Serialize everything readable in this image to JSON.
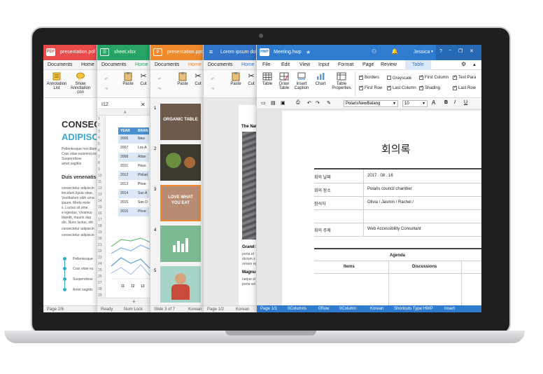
{
  "pdf": {
    "badge": "PDF",
    "title": "presentation.pdf",
    "menu": [
      "Documents",
      "Home"
    ],
    "tools": [
      "Annotation List",
      "Show Annotation con"
    ],
    "heading1": "CONSEC",
    "heading2": "ADIPISC",
    "body_lines": [
      "Pellentesque non libero",
      "Cras vitae euismod es",
      "Suspendisse",
      "amet sagittis"
    ],
    "subheading": "Duis venenatis",
    "para_lines": [
      "consectetur adipiscin",
      "tincidunt ligula vitae,",
      "Vestibulum nibh urna",
      "ipsum. Morbi mole",
      "s. Luctus sit ame",
      "e egestas. Vivamus",
      "blandit, mauris dap",
      "din. Nunc luctus, elit",
      "consectetur adipiscin",
      "consectetur adipiscin"
    ],
    "bullets": [
      "Pellentesque",
      "Cras vitae eu",
      "Suspendisse",
      "Amet sagittis"
    ],
    "status": "Page 2/6",
    "color": "#e94b4b"
  },
  "sheet": {
    "title": "sheet.xlsx",
    "menu": [
      "Documents",
      "Home"
    ],
    "tools": [
      "Paste",
      "Cut"
    ],
    "cellref": "I12",
    "col_header": "A",
    "table_headers": [
      "YEAR",
      "BRAN"
    ],
    "years": [
      "2006",
      "2007",
      "2008",
      "2011",
      "2012",
      "2013",
      "2014",
      "2015",
      "2016"
    ],
    "brands": [
      "New",
      "Los A",
      "Atlan",
      "Hous",
      "Philad",
      "Phoe",
      "San A",
      "San D",
      "Phoe"
    ],
    "row_numbers": [
      "1",
      "2",
      "3",
      "4",
      "5",
      "6",
      "7",
      "8",
      "9",
      "10",
      "11",
      "12",
      "13",
      "14",
      "15",
      "16",
      "17",
      "18",
      "19",
      "20",
      "21",
      "22",
      "23",
      "24",
      "25",
      "26",
      "27",
      "28",
      "29"
    ],
    "chart_ticks": [
      "11",
      "12",
      "13"
    ],
    "status": [
      "Ready",
      "Num Lock"
    ],
    "color": "#27a465"
  },
  "slides": {
    "badge": "P",
    "title": "presentation.pptx",
    "menu": [
      "Documents",
      "Home"
    ],
    "tools": [
      "Paste",
      "Cut"
    ],
    "thumb_numbers": [
      "1",
      "2",
      "3",
      "4",
      "5"
    ],
    "thumb_texts": [
      "ORGANIC TABLE",
      "",
      "LOVE WHAT YOU EAT",
      "",
      ""
    ],
    "status": [
      "Slide 3 of 7",
      "Korean"
    ],
    "color": "#ee8a2b"
  },
  "word": {
    "title": "Lorem ipsum dolo",
    "menu": [
      "Documents",
      "Home"
    ],
    "tools": [
      "Paste",
      "Cut"
    ],
    "page_title": "The Nat",
    "caption1": "Grand N",
    "caption_lines": [
      "porta et",
      "dictum s",
      "ornare eg"
    ],
    "caption2": "Magnus",
    "caption2_lines": [
      "neque el",
      "porta vel"
    ],
    "status": [
      "Page 1/2",
      "Korean"
    ],
    "color": "#3174c8"
  },
  "hwp": {
    "badge": "HWP",
    "title": "Meeting.hwp",
    "user": "Jessica",
    "menu": [
      "File",
      "Edit",
      "View",
      "Input",
      "Format",
      "Page",
      "Review",
      "Table"
    ],
    "ribbon_buttons": [
      "Table",
      "Draw Table",
      "Insert Caption",
      "Chart",
      "Table Properties"
    ],
    "checks": [
      {
        "label": "Borders",
        "on": true
      },
      {
        "label": "First Row",
        "on": true
      },
      {
        "label": "Grayscale",
        "on": false
      },
      {
        "label": "Last Column",
        "on": true
      },
      {
        "label": "First Column",
        "on": true
      },
      {
        "label": "Shading",
        "on": true
      },
      {
        "label": "Text Para",
        "on": true
      },
      {
        "label": "Last Row",
        "on": true
      }
    ],
    "font_name": "PolarisNewBatang",
    "font_size": "10",
    "fmt_buttons": [
      "B",
      "I",
      "U"
    ],
    "doc_title": "회의록",
    "rows": [
      {
        "label": "회의 날짜",
        "value": "2017 . 08 . 16"
      },
      {
        "label": "회의 장소",
        "value": "Polaris council chamber"
      },
      {
        "label": "참석자",
        "value": "Olivia / Jasmin / Rachel /"
      },
      {
        "label": "",
        "value": ""
      },
      {
        "label": "회의 주제",
        "value": "Web Accessibility Consultant"
      }
    ],
    "agenda": "Agenda",
    "agenda_cols": [
      "Items",
      "Discussions"
    ],
    "status": [
      "Page 1/1",
      "0Columns",
      "0Row",
      "0Column",
      "Korean",
      "Shortcuts Type:HWP",
      "Insert"
    ],
    "color": "#2e7bcf"
  }
}
